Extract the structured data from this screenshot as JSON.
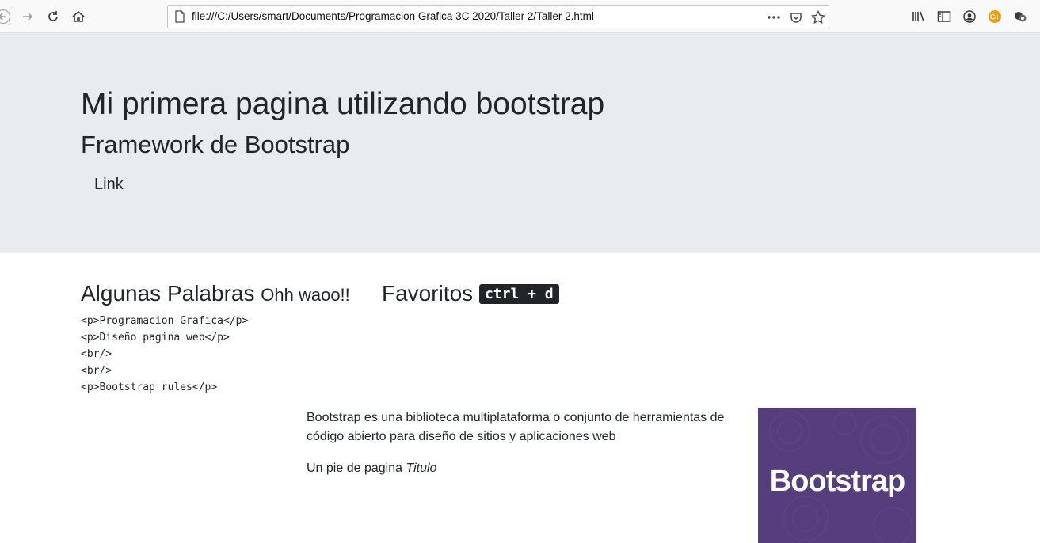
{
  "browser": {
    "url": "file:///C:/Users/smart/Documents/Programacion Grafica 3C 2020/Taller 2/Taller 2.html",
    "icons": {
      "back": "back-arrow-icon",
      "forward": "forward-arrow-icon",
      "reload": "reload-icon",
      "home": "home-icon",
      "page": "page-icon",
      "more": "more-icon",
      "pocket": "pocket-icon",
      "bookmark": "star-icon",
      "library": "library-icon",
      "sidebar": "sidebar-icon",
      "account": "account-icon",
      "extension": "extension-icon",
      "extension2": "extension-icon"
    },
    "extension_label": "G+"
  },
  "jumbotron": {
    "title": "Mi primera pagina utilizando bootstrap",
    "subtitle": "Framework de Bootstrap",
    "link": "Link"
  },
  "section1": {
    "heading": "Algunas Palabras",
    "small": "Ohh waoo!!",
    "code_lines": [
      "<p>Programacion Grafica</p>",
      "<p>Diseño pagina web</p>",
      "<br/>",
      "<br/>",
      "<p>Bootstrap rules</p>"
    ]
  },
  "section2": {
    "heading": "Favoritos",
    "kbd": "ctrl + d"
  },
  "content": {
    "description": "Bootstrap es una biblioteca multiplataforma o conjunto de herramientas de código abierto para diseño de sitios y aplicaciones web",
    "footer_prefix": "Un pie de pagina",
    "footer_cite": "Titulo"
  },
  "logo": {
    "text": "Bootstrap",
    "bg_color": "#563d7c"
  },
  "colors": {
    "jumbotron_bg": "#e9ecef",
    "text": "#212529"
  }
}
